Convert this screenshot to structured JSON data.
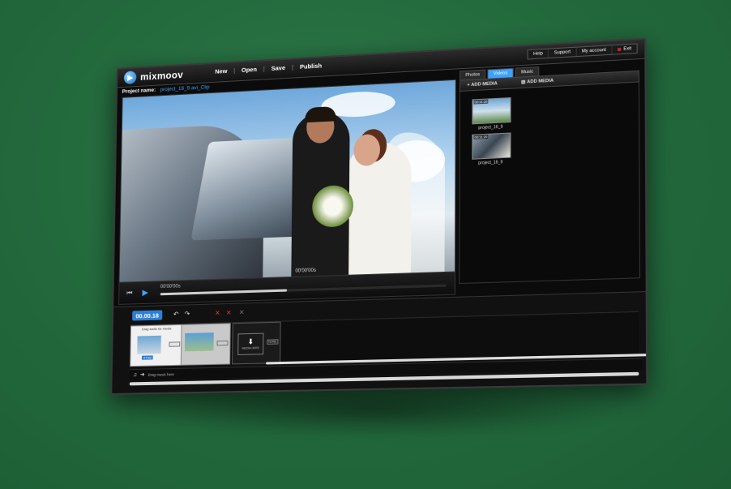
{
  "app": {
    "logo_text": "mixmoov",
    "menu": [
      "New",
      "Open",
      "Save",
      "Publish"
    ],
    "right_menu": [
      "Help",
      "Support",
      "My account",
      "Exit"
    ]
  },
  "project": {
    "label": "Project name:",
    "value": "project_16_9.avi_Clip"
  },
  "player": {
    "time_current": "00'00'00s",
    "time_total": "00'00'00s",
    "progress_fraction": 0.45
  },
  "media_panel": {
    "tabs": [
      "Photos",
      "Videos",
      "Music"
    ],
    "active_tab": "Videos",
    "add_media_label": "ADD MEDIA",
    "items": [
      {
        "label": "project_16_9",
        "time": "00:11:20"
      },
      {
        "label": "project_16_9",
        "time": "00:11:20"
      }
    ]
  },
  "timeline": {
    "timecode": "00.00.18",
    "drag_audio_text": "Drag audio for media",
    "drop_media_text": "MEDIA HERE",
    "none_tag": "NONE",
    "music_text": "Drag music here",
    "clip_time": "27:00"
  }
}
